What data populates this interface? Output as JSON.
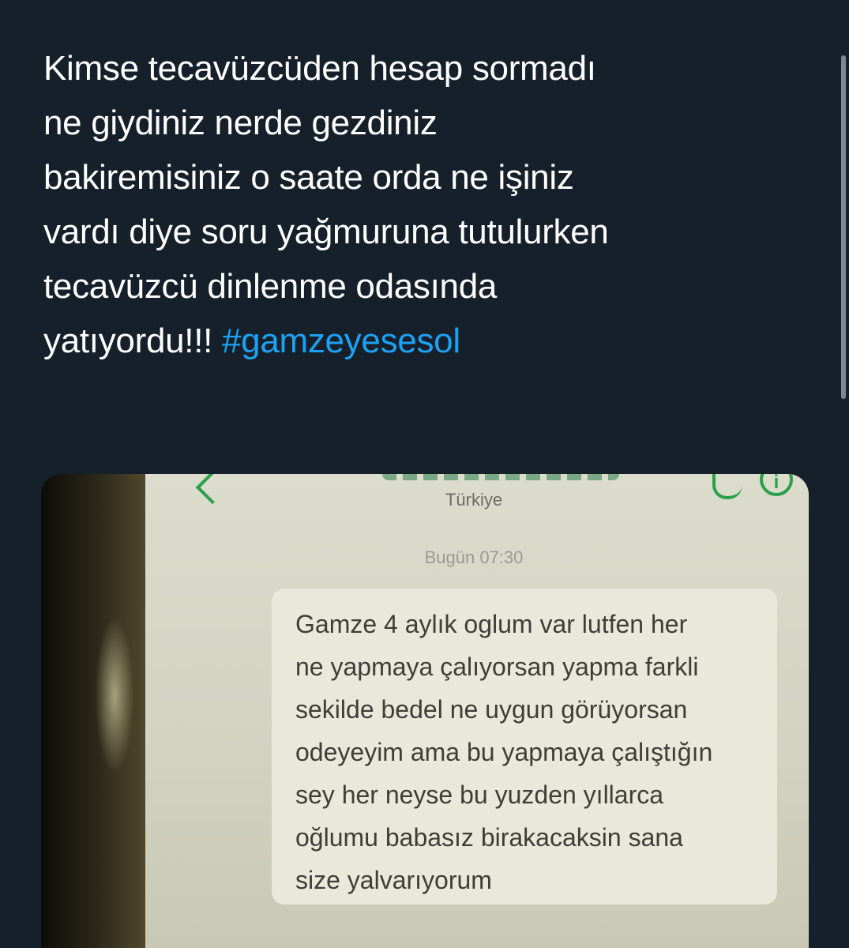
{
  "tweet": {
    "lines": [
      "Kimse tecavüzcüden hesap sormadı",
      "ne giydiniz nerde gezdiniz",
      "bakiremisiniz o saate orda ne işiniz",
      "vardı diye soru yağmuruna tutulurken",
      "tecavüzcü dinlenme odasında",
      "yatıyordu!!! "
    ],
    "hashtag": "#gamzeyesesol"
  },
  "sms": {
    "country": "Türkiye",
    "timestamp": "Bugün 07:30",
    "message_lines": [
      "Gamze 4 aylık oglum var lutfen her",
      "ne yapmaya çalıyorsan yapma farkli",
      "sekilde bedel ne uygun görüyorsan",
      "odeyeyim ama bu yapmaya çalıştığın",
      "sey her neyse bu yuzden yıllarca",
      "oğlumu babasız birakacaksin sana",
      "size yalvarıyorum"
    ]
  },
  "icons": {
    "back": "chevron-left-icon",
    "call": "phone-icon",
    "info": "info-icon"
  },
  "colors": {
    "background": "#15202b",
    "text": "#ffffff",
    "hashtag": "#1da1f2",
    "sms_accent": "#2aa04a"
  }
}
